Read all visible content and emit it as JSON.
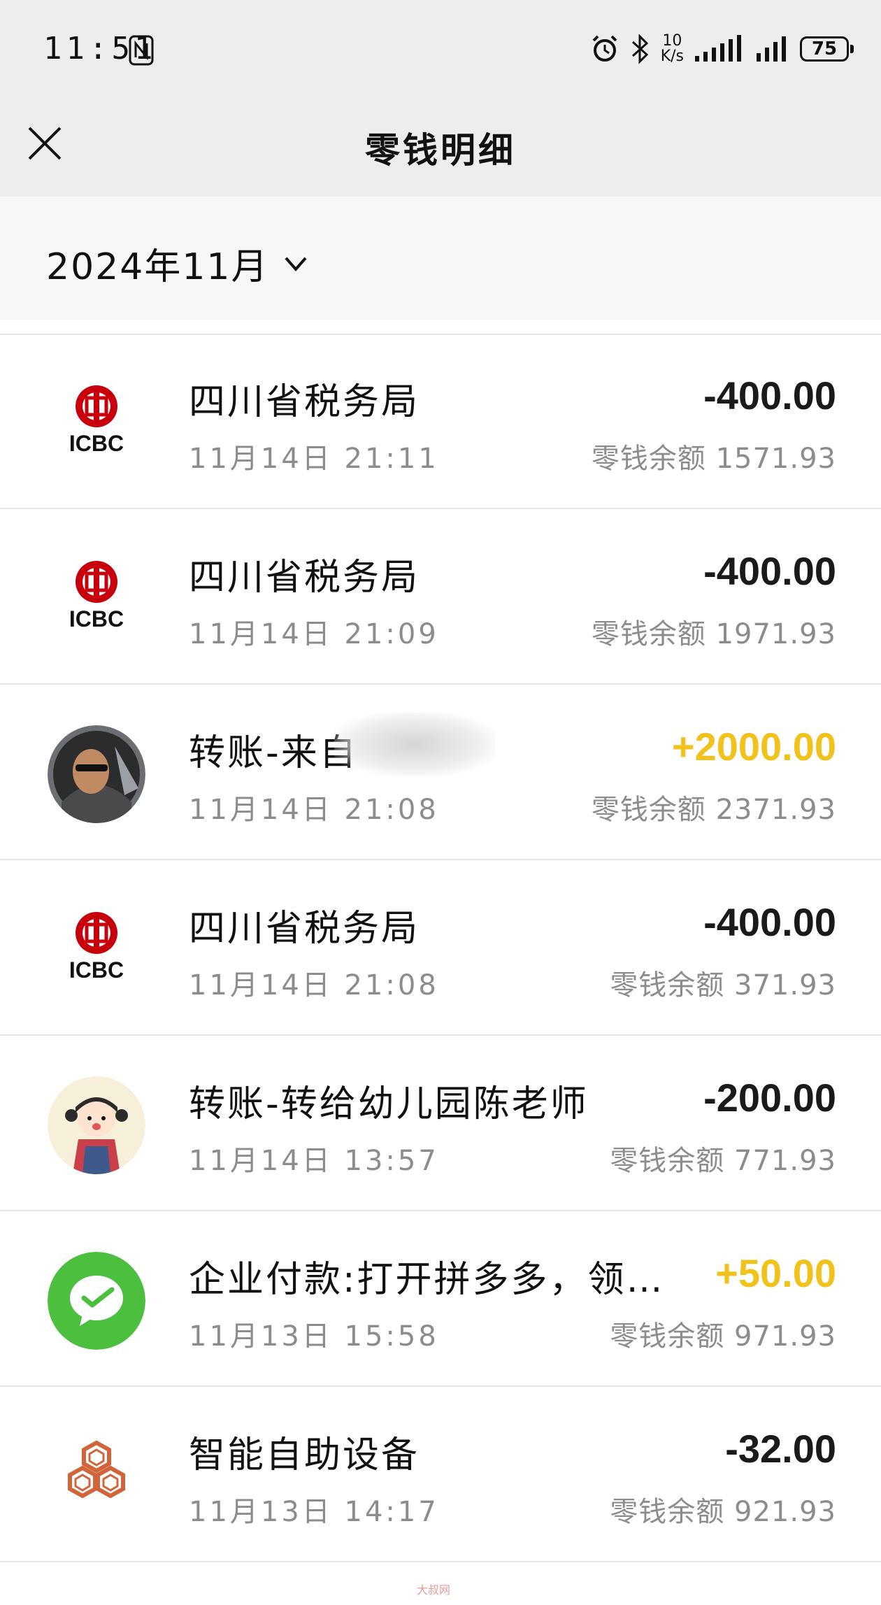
{
  "status_bar": {
    "time": "11:51",
    "net_speed_value": "10",
    "net_speed_unit": "K/s",
    "battery": "75"
  },
  "nav": {
    "title": "零钱明细"
  },
  "filter": {
    "month": "2024年11月"
  },
  "transactions": [
    {
      "name": "四川省税务局",
      "time": "11月14日 21:11",
      "amount": "-400.00",
      "balance": "零钱余额 1571.93"
    },
    {
      "name": "四川省税务局",
      "time": "11月14日 21:09",
      "amount": "-400.00",
      "balance": "零钱余额 1971.93"
    },
    {
      "name": "转账-来自",
      "time": "11月14日 21:08",
      "amount": "+2000.00",
      "balance": "零钱余额 2371.93"
    },
    {
      "name": "四川省税务局",
      "time": "11月14日 21:08",
      "amount": "-400.00",
      "balance": "零钱余额 371.93"
    },
    {
      "name": "转账-转给幼儿园陈老师",
      "time": "11月14日 13:57",
      "amount": "-200.00",
      "balance": "零钱余额 771.93"
    },
    {
      "name": "企业付款:打开拼多多，领…",
      "time": "11月13日 15:58",
      "amount": "+50.00",
      "balance": "零钱余额 971.93"
    },
    {
      "name": "智能自助设备",
      "time": "11月13日 14:17",
      "amount": "-32.00",
      "balance": "零钱余额 921.93"
    }
  ],
  "icons": {
    "icbc_logo_text": "ICBC",
    "colors": {
      "icbc_red": "#c7000b",
      "wechat_green": "#4cbf3e",
      "positive_amount": "#f0c21b"
    }
  },
  "watermark": "大叔网"
}
